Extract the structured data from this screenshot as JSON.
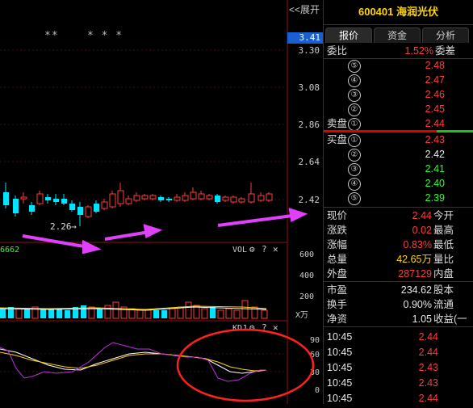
{
  "toolbar": {
    "collapse_label": "<<展开"
  },
  "price_axis": {
    "current": "3.41",
    "ticks": [
      "3.30",
      "3.08",
      "2.86",
      "2.64",
      "2.42"
    ]
  },
  "chart": {
    "markers": "**    * * *",
    "low_label": "2.26",
    "left_edge_value": "6662",
    "vol_label": "VOL",
    "vol_ticks": [
      "600",
      "400",
      "200"
    ],
    "vol_unit": "X万",
    "kdj_label": "KDJ",
    "kdj_ticks": [
      "90",
      "60",
      "30",
      "0"
    ]
  },
  "stock": {
    "code": "600401",
    "name": "海润光伏"
  },
  "tabs": [
    "报价",
    "资金",
    "分析"
  ],
  "ratio": {
    "label": "委比",
    "value": "1.52%",
    "label2": "委差"
  },
  "sell_levels": [
    {
      "label": "",
      "num": "⑤",
      "price": "2.48",
      "color": "red"
    },
    {
      "label": "",
      "num": "④",
      "price": "2.47",
      "color": "red"
    },
    {
      "label": "",
      "num": "③",
      "price": "2.46",
      "color": "red"
    },
    {
      "label": "",
      "num": "②",
      "price": "2.45",
      "color": "red"
    },
    {
      "label": "卖盘",
      "num": "①",
      "price": "2.44",
      "color": "red"
    }
  ],
  "buy_levels": [
    {
      "label": "买盘",
      "num": "①",
      "price": "2.43",
      "color": "red"
    },
    {
      "label": "",
      "num": "②",
      "price": "2.42",
      "color": "white"
    },
    {
      "label": "",
      "num": "③",
      "price": "2.41",
      "color": "green"
    },
    {
      "label": "",
      "num": "④",
      "price": "2.40",
      "color": "green"
    },
    {
      "label": "",
      "num": "⑤",
      "price": "2.39",
      "color": "green"
    }
  ],
  "quote": [
    {
      "l1": "现价",
      "v1": "2.44",
      "c1": "red",
      "l2": "今开"
    },
    {
      "l1": "涨跌",
      "v1": "0.02",
      "c1": "red",
      "l2": "最高"
    },
    {
      "l1": "涨幅",
      "v1": "0.83%",
      "c1": "red",
      "l2": "最低"
    },
    {
      "l1": "总量",
      "v1": "42.65万",
      "c1": "yellow",
      "l2": "量比"
    },
    {
      "l1": "外盘",
      "v1": "287129",
      "c1": "red",
      "l2": "内盘"
    }
  ],
  "fundamentals": [
    {
      "l1": "市盈",
      "v1": "234.62",
      "l2": "股本"
    },
    {
      "l1": "换手",
      "v1": "0.90%",
      "l2": "流通"
    },
    {
      "l1": "净资",
      "v1": "1.05",
      "l2": "收益(一"
    }
  ],
  "ticks": [
    {
      "time": "10:45",
      "price": "2.44",
      "color": "red"
    },
    {
      "time": "10:45",
      "price": "2.44",
      "color": "red"
    },
    {
      "time": "10:45",
      "price": "2.43",
      "color": "red"
    },
    {
      "time": "10:45",
      "price": "2.43",
      "color": "red"
    },
    {
      "time": "10:45",
      "price": "2.44",
      "color": "red"
    }
  ],
  "colors": {
    "up": "#ff3b3b",
    "down": "#00e5ff",
    "annotation": "#e040fb",
    "circle": "#ff2020"
  }
}
